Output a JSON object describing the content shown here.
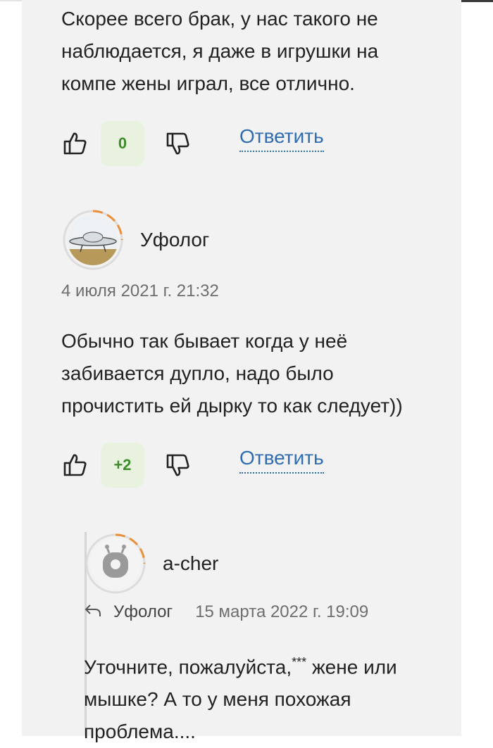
{
  "comments": [
    {
      "text": "Скорее всего брак, у нас такого не наблюдается, я даже в игрушки на компе жены играл, все отлично.",
      "lines": [
        "Скорее всего брак, у нас такого не",
        "наблюдается, я даже в игрушки на",
        "компе жены играл, все отлично."
      ],
      "score": "0",
      "reply_label": "Ответить"
    },
    {
      "author": "Уфолог",
      "avatar": "ufo-photo",
      "datetime": "4 июля 2021 г. 21:32",
      "lines": [
        "Обычно так бывает когда у неё",
        "забивается дупло, надо было",
        "прочистить ей дырку то как следует))"
      ],
      "score": "+2",
      "reply_label": "Ответить"
    },
    {
      "author": "a-cher",
      "avatar": "robot-icon",
      "reply_to": "Уфолог",
      "datetime": "15 марта 2022 г. 19:09",
      "lines": [
        "Уточните, пожалуйста,",
        "мышке? А то у меня похожая",
        "проблема...."
      ],
      "line1_mark": "***",
      "line1_tail": " жене или"
    }
  ],
  "colors": {
    "score_bg": "#e8f2de",
    "score_text": "#3f8a2a",
    "link": "#2f6db0",
    "ring_accent": "#e8913a"
  },
  "icons": [
    "thumbs-up-icon",
    "thumbs-down-icon",
    "reply-arrow-icon"
  ]
}
